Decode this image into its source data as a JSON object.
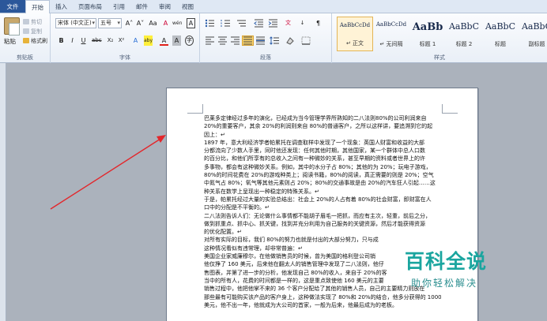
{
  "tabs": [
    {
      "label": "文件",
      "kind": "file"
    },
    {
      "label": "开始",
      "kind": "active"
    },
    {
      "label": "插入",
      "kind": ""
    },
    {
      "label": "页面布局",
      "kind": ""
    },
    {
      "label": "引用",
      "kind": ""
    },
    {
      "label": "邮件",
      "kind": ""
    },
    {
      "label": "审阅",
      "kind": ""
    },
    {
      "label": "视图",
      "kind": ""
    }
  ],
  "clipboard": {
    "paste_label": "粘贴",
    "cut_label": "剪切",
    "copy_label": "复制",
    "format_painter_label": "格式刷",
    "group_label": "剪贴板"
  },
  "font": {
    "name": "宋体 (中文正)",
    "size": "五号",
    "grow_label": "A˄",
    "shrink_label": "A˅",
    "case_label": "Aa",
    "clear_label": "A",
    "phonetic_label": "wén",
    "border_label": "A",
    "bold_label": "B",
    "italic_label": "I",
    "underline_label": "U",
    "strike_label": "abc",
    "sub_label": "X₂",
    "sup_label": "X²",
    "effects_label": "A",
    "highlight_label": "aby",
    "color_label": "A",
    "shade_label": "A",
    "enclose_label": "字",
    "group_label": "字体"
  },
  "paragraph": {
    "group_label": "段落"
  },
  "styles": {
    "items": [
      {
        "sample": "AaBbCcDd",
        "name": "↵ 正文",
        "selected": true,
        "size": "7px"
      },
      {
        "sample": "AaBbCcDd",
        "name": "↵ 无间隔",
        "selected": false,
        "size": "7px"
      },
      {
        "sample": "AaBb",
        "name": "标题 1",
        "selected": false,
        "size": "13px"
      },
      {
        "sample": "AaBbC",
        "name": "标题 2",
        "selected": false,
        "size": "11px"
      },
      {
        "sample": "AaBbC",
        "name": "标题",
        "selected": false,
        "size": "11px"
      },
      {
        "sample": "AaBbC",
        "name": "副标题",
        "selected": false,
        "size": "11px"
      }
    ],
    "group_label": "样式"
  },
  "document": {
    "lines": [
      "巴莱多定律经过多年的演化，已经成为当今管理学界所熟知的二八法则80%的公司利润来自",
      "20%的重要客户，其余 20%的利润则来自 80%的普通客户，之所以这样讲，要追溯到它的起",
      "因上：↵",
      "1897 年，意大利经济学者帕累托在调查取样中发现了一个现象：英国人财富和收益的大部",
      "分都流向了少数人手里，同时他还发现：任何其他时期，其他国家，某一个群体中总人口数",
      "的百分比，和他们所享有的总收入之间有一种微妙的关系，甚至早期的资料或者世界上的许",
      "多事物，都会有这种微妙关系。例如，其中的水分子占 80%；其他的为 20%；玩电子游戏，",
      "80%的时间花费在 20%的游戏种类上；阅读书籍，80%的阅读，真正需要的则是 20%；空气",
      "中氮气占 80%；氧气等其他元素则占 20%；80%的交通事故是由 20%的汽车狂人引起……这",
      "种关系在数学上呈现出一种稳定的特殊关系。↵",
      "于是，帕累托经过大量的实验总结出：社会上 20%的人占有着 80%的社会财富，即财富在人",
      "口中的分配是不平衡的。↵",
      "二八法则告诉人们：无论做什么事情都不能胡子眉毛一把抓，而应有主次，轻重，前后之分，",
      "做到抓重点、抓中心、抓关键，找到并充分利用为自己服务的关键资源，然后才能获得资源",
      "的优化配置。↵",
      "对所有实际的目标，我们 80%的努力也就是付出的大部分努力，只与成",
      "这种情况看似有违常理，却非常普遍：↵",
      "美国企业家威廉穆尔，在他做销售员的时候，曾为美国的格利登公司销",
      "他仅挣了 160 美元，后来他在翻太人的销售管理中发现了二八法则，他仔",
      "售图表，并第了进一步的分析，他发现自己 80%的收入，来自于 20%的客",
      "当中的所有人，花费的时间都是一样的，这是重点致使他 160 美元的主要",
      "销售过程中，他把他掌不来的 36 个客户分配给了其他的销售人员，自己的主要精力则放在",
      "那些最有可能购买该产品的客户身上，这种做法实现了 80%和 20%的结合，他多分获得的 1000",
      "美元，他不出一年，他就成为大公司的首家，一般为后来，他最后成为的老板。"
    ]
  },
  "watermark": {
    "title": "百科全说",
    "subtitle": "助你轻松解决"
  }
}
